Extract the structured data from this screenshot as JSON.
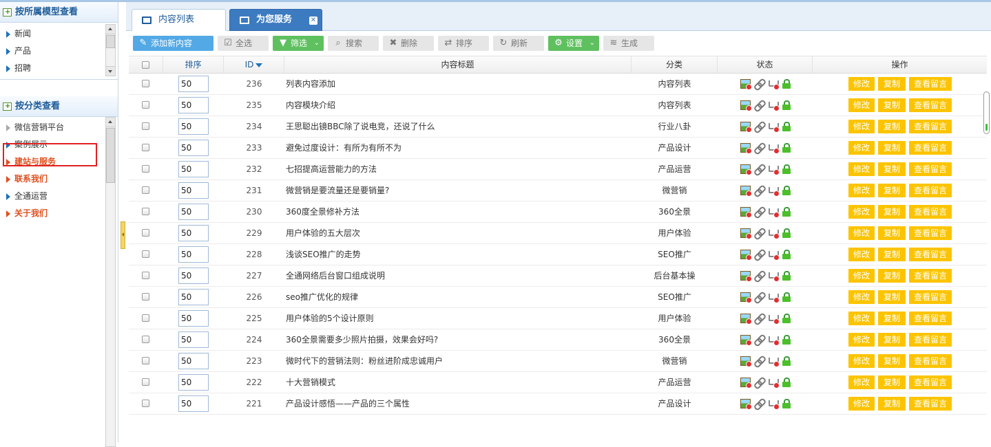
{
  "left_panel": {
    "by_model": {
      "title": "按所属模型查看",
      "items": [
        "新闻",
        "产品",
        "招聘"
      ]
    },
    "by_category": {
      "title": "按分类查看",
      "items": [
        {
          "label": "微信营销平台",
          "style": "gray"
        },
        {
          "label": "案例展示",
          "style": "normal"
        },
        {
          "label": "建站与服务",
          "style": "hot"
        },
        {
          "label": "联系我们",
          "style": "hot"
        },
        {
          "label": "全通运营",
          "style": "normal"
        },
        {
          "label": "关于我们",
          "style": "hot"
        }
      ]
    }
  },
  "tabs": [
    {
      "label": "内容列表",
      "active": true
    },
    {
      "label": "为您服务",
      "active": false
    }
  ],
  "toolbar": {
    "add": "添加新内容",
    "select_all": "全选",
    "filter": "筛选",
    "search": "搜索",
    "delete": "删除",
    "sort": "排序",
    "refresh": "刷新",
    "settings": "设置",
    "generate": "生成"
  },
  "table": {
    "headers": {
      "sort": "排序",
      "id": "ID",
      "title": "内容标题",
      "category": "分类",
      "status": "状态",
      "actions": "操作"
    },
    "action_labels": {
      "edit": "修改",
      "copy": "复制",
      "comments": "查看留言"
    },
    "rows": [
      {
        "sort": "50",
        "id": "236",
        "title": "列表内容添加",
        "category": "内容列表"
      },
      {
        "sort": "50",
        "id": "235",
        "title": "内容模块介绍",
        "category": "内容列表"
      },
      {
        "sort": "50",
        "id": "234",
        "title": "王思聪出镜BBC除了说电竞，还说了什么",
        "category": "行业八卦"
      },
      {
        "sort": "50",
        "id": "233",
        "title": "避免过度设计：有所为有所不为",
        "category": "产品设计"
      },
      {
        "sort": "50",
        "id": "232",
        "title": "七招提高运营能力的方法",
        "category": "产品运营"
      },
      {
        "sort": "50",
        "id": "231",
        "title": "微营销是要流量还是要销量?",
        "category": "微营销"
      },
      {
        "sort": "50",
        "id": "230",
        "title": "360度全景修补方法",
        "category": "360全景"
      },
      {
        "sort": "50",
        "id": "229",
        "title": "用户体验的五大层次",
        "category": "用户体验"
      },
      {
        "sort": "50",
        "id": "228",
        "title": "浅谈SEO推广的走势",
        "category": "SEO推广"
      },
      {
        "sort": "50",
        "id": "227",
        "title": "全通网络后台窗口组成说明",
        "category": "后台基本操"
      },
      {
        "sort": "50",
        "id": "226",
        "title": "seo推广优化的规律",
        "category": "SEO推广"
      },
      {
        "sort": "50",
        "id": "225",
        "title": "用户体验的5个设计原则",
        "category": "用户体验"
      },
      {
        "sort": "50",
        "id": "224",
        "title": "360全景需要多少照片拍摄，效果会好吗?",
        "category": "360全景"
      },
      {
        "sort": "50",
        "id": "223",
        "title": "微时代下的营销法则：粉丝进阶成忠诚用户",
        "category": "微营销"
      },
      {
        "sort": "50",
        "id": "222",
        "title": "十大营销模式",
        "category": "产品运营"
      },
      {
        "sort": "50",
        "id": "221",
        "title": "产品设计感悟——产品的三个属性",
        "category": "产品设计"
      }
    ]
  }
}
